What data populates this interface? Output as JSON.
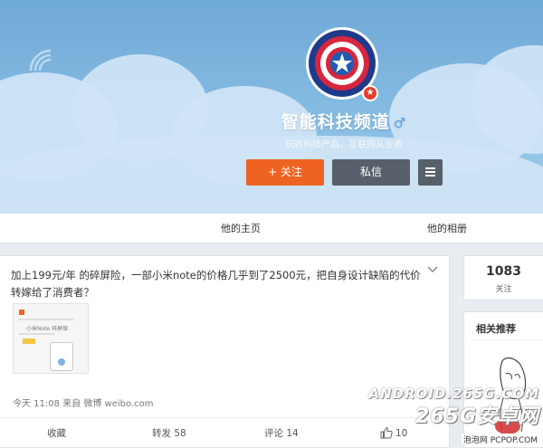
{
  "profile": {
    "name": "智能科技频道",
    "gender_symbol": "♂",
    "bio": "玩转科技产品，互联网从业者",
    "verified_badge": "★"
  },
  "actions": {
    "follow_label": "+ 关注",
    "message_label": "私信"
  },
  "tabs": [
    {
      "label": "他的主页"
    },
    {
      "label": "他的相册"
    }
  ],
  "post": {
    "text": "加上199元/年 的碎屏险，一部小米note的价格几乎到了2500元，把自身设计缺陷的代价转嫁给了消费者？",
    "expand_icon": "chevron-down-icon",
    "thumbnail_text": "小米Note 碎屏保",
    "meta": "今天 11:08 来自 微博 weibo.com",
    "buttons": {
      "collect": "收藏",
      "repost": "转发 58",
      "comment": "评论 14",
      "like": "10"
    }
  },
  "sidebar": {
    "following_count": "1083",
    "following_label": "关注",
    "related_title": "相关推荐"
  },
  "watermark": {
    "line1": "ANDROID.265G.COM",
    "line2": "265G安卓网",
    "line3": "泡泡网 PCPOP.COM"
  },
  "colors": {
    "follow": "#ef6322",
    "message": "#57606a",
    "cover": "#86bce3",
    "gender": "#5aa0e8",
    "badge": "#e2402c"
  }
}
